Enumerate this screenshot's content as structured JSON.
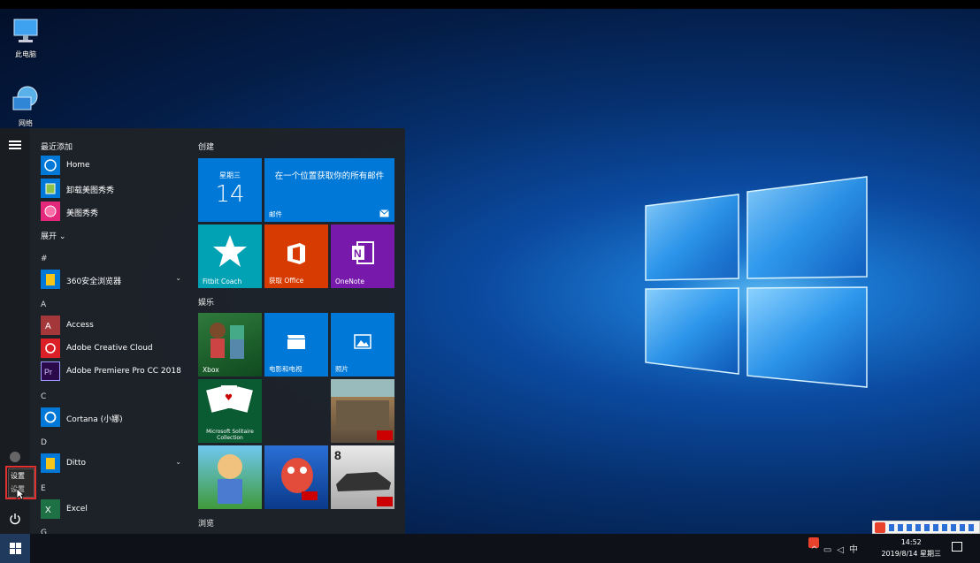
{
  "desktop": {
    "icons": [
      {
        "label": "此电脑",
        "icon": "computer-icon"
      },
      {
        "label": "网络",
        "icon": "network-icon"
      }
    ]
  },
  "start_menu": {
    "recent_header": "最近添加",
    "recent_apps": [
      {
        "label": "Home",
        "icon": "home-icon"
      },
      {
        "label": "卸载美图秀秀",
        "icon": "uninstall-icon"
      },
      {
        "label": "美图秀秀",
        "icon": "meitu-icon"
      }
    ],
    "expand_label": "展开",
    "sections": [
      {
        "letter": "#",
        "apps": [
          {
            "label": "360安全浏览器",
            "icon": "folder-icon",
            "expandable": true
          }
        ]
      },
      {
        "letter": "A",
        "apps": [
          {
            "label": "Access",
            "icon": "access-icon"
          },
          {
            "label": "Adobe Creative Cloud",
            "icon": "creative-cloud-icon"
          },
          {
            "label": "Adobe Premiere Pro CC 2018",
            "icon": "premiere-icon"
          }
        ]
      },
      {
        "letter": "C",
        "apps": [
          {
            "label": "Cortana (小娜)",
            "icon": "cortana-icon"
          }
        ]
      },
      {
        "letter": "D",
        "apps": [
          {
            "label": "Ditto",
            "icon": "folder-icon",
            "expandable": true
          }
        ]
      },
      {
        "letter": "E",
        "apps": [
          {
            "label": "Excel",
            "icon": "excel-icon"
          }
        ]
      },
      {
        "letter": "G",
        "apps": []
      }
    ],
    "rail": {
      "settings_tooltip": "设置",
      "settings_tooltip_sub": "设置"
    },
    "groups": [
      {
        "title": "创建"
      },
      {
        "title": "娱乐"
      },
      {
        "title": "浏览"
      }
    ],
    "tiles": {
      "calendar_day": "星期三",
      "calendar_date": "14",
      "mail_text": "在一个位置获取你的所有邮件",
      "mail_label": "邮件",
      "fitbit": "Fitbit Coach",
      "office": "获取 Office",
      "onenote": "OneNote",
      "xbox": "Xbox",
      "movies": "电影和电视",
      "photos": "照片",
      "solitaire": "Microsoft Solitaire Collection"
    }
  },
  "taskbar": {
    "time": "14:52",
    "date": "2019/8/14 星期三"
  },
  "colors": {
    "accent": "#0078d7",
    "office": "#d83b01",
    "onenote": "#7719aa",
    "highlight": "#e03030"
  }
}
